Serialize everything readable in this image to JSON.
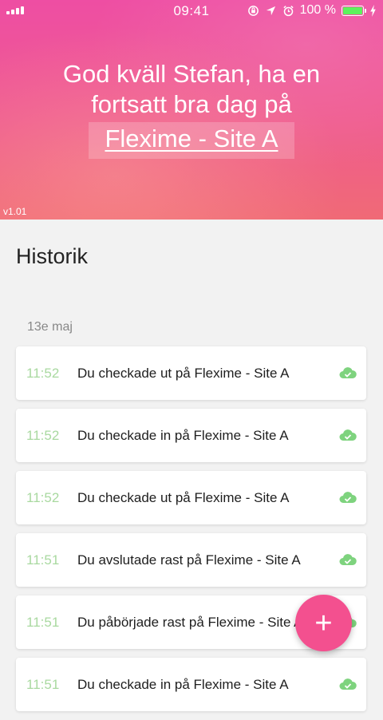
{
  "status": {
    "time": "09:41",
    "battery": "100 %"
  },
  "header": {
    "greeting": "God kväll Stefan, ha en fortsatt bra dag på",
    "site": "Flexime - Site A",
    "version": "v1.01"
  },
  "history": {
    "title": "Historik",
    "date": "13e maj",
    "items": [
      {
        "time": "11:52",
        "text": "Du checkade ut på Flexime - Site A"
      },
      {
        "time": "11:52",
        "text": "Du checkade in på Flexime - Site A"
      },
      {
        "time": "11:52",
        "text": "Du checkade ut på Flexime - Site A"
      },
      {
        "time": "11:51",
        "text": "Du avslutade rast på Flexime - Site A"
      },
      {
        "time": "11:51",
        "text": "Du påbörjade rast på Flexime - Site A"
      },
      {
        "time": "11:51",
        "text": "Du checkade in på Flexime - Site A"
      }
    ]
  },
  "fab": {
    "label": "+"
  },
  "colors": {
    "accent": "#f3508f",
    "sync": "#7ed37e",
    "time_text": "#a9d9a0"
  }
}
